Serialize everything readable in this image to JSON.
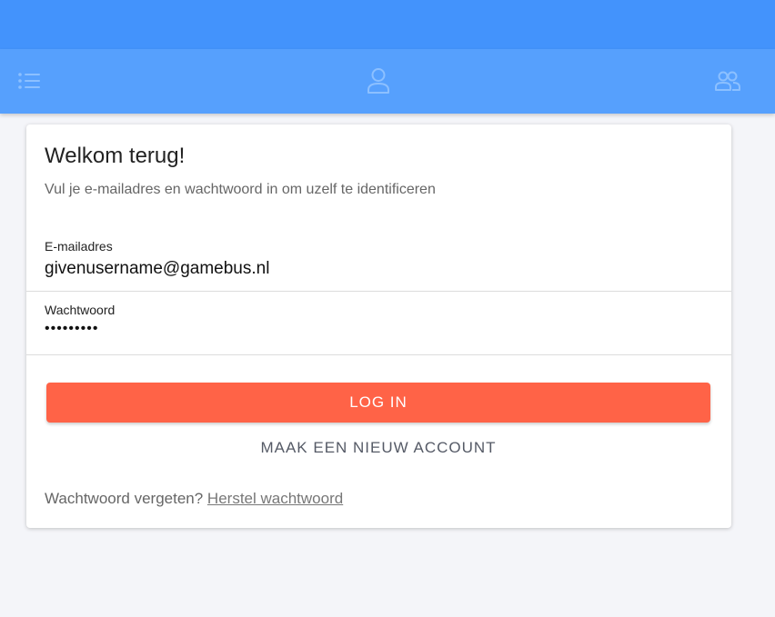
{
  "colors": {
    "topbar": "#4393fc",
    "navbar": "#56a0fd",
    "primary_button": "#ff6347",
    "page_background": "#f4f5f9"
  },
  "nav": {
    "items": [
      {
        "icon": "list-icon"
      },
      {
        "icon": "user-icon"
      },
      {
        "icon": "group-icon"
      }
    ]
  },
  "login": {
    "title": "Welkom terug!",
    "subtitle": "Vul je e-mailadres en wachtwoord in om uzelf te identificeren",
    "email": {
      "label": "E-mailadres",
      "value": "givenusername@gamebus.nl"
    },
    "password": {
      "label": "Wachtwoord",
      "masked_value": "•••••••••"
    },
    "login_button": "LOG IN",
    "new_account_button": "MAAK EEN NIEUW ACCOUNT",
    "forgot_text": "Wachtwoord vergeten?",
    "reset_link": "Herstel wachtwoord"
  }
}
